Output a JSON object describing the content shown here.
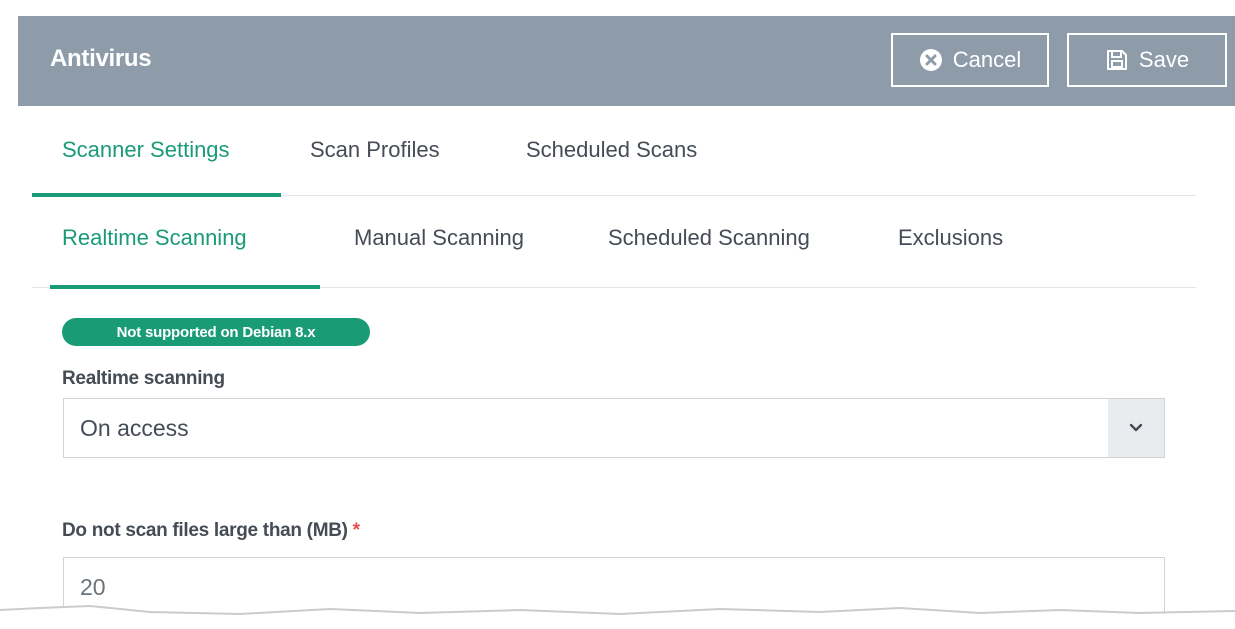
{
  "header": {
    "title": "Antivirus",
    "cancel_label": "Cancel",
    "save_label": "Save"
  },
  "tabs": [
    "Scanner Settings",
    "Scan Profiles",
    "Scheduled Scans"
  ],
  "subtabs": [
    "Realtime Scanning",
    "Manual Scanning",
    "Scheduled Scanning",
    "Exclusions"
  ],
  "active_tab": "Scanner Settings",
  "active_subtab": "Realtime Scanning",
  "badge": "Not supported on Debian 8.x",
  "realtime": {
    "label": "Realtime scanning",
    "value": "On access"
  },
  "max_size": {
    "label": "Do not scan files large than (MB)",
    "required_mark": "*",
    "value": "20"
  },
  "icons": {
    "cancel": "circle-x-icon",
    "save": "floppy-disk-icon",
    "dropdown": "chevron-down-icon"
  },
  "colors": {
    "header_bg": "#8e9caa",
    "accent": "#1a9b77",
    "required": "#e0504b"
  }
}
